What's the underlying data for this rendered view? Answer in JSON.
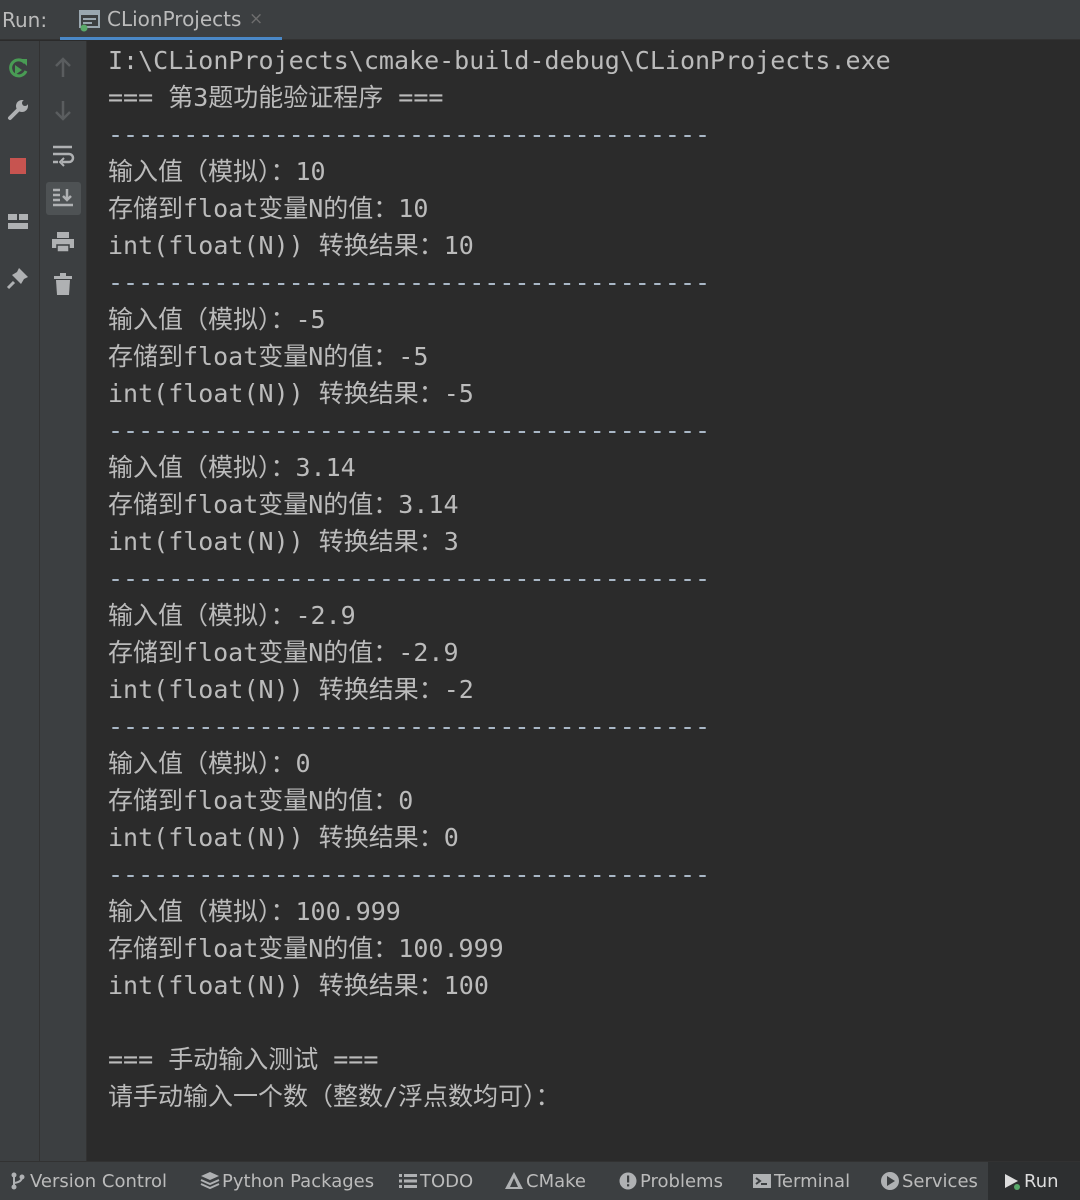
{
  "header": {
    "run_label": "Run:",
    "tab_title": "CLionProjects",
    "tab_close": "×"
  },
  "console": {
    "lines": [
      "I:\\CLionProjects\\cmake-build-debug\\CLionProjects.exe",
      "=== 第3题功能验证程序 ===",
      "----------------------------------------",
      "输入值（模拟）：10",
      "存储到float变量N的值：10",
      "int(float(N)) 转换结果：10",
      "----------------------------------------",
      "输入值（模拟）：-5",
      "存储到float变量N的值：-5",
      "int(float(N)) 转换结果：-5",
      "----------------------------------------",
      "输入值（模拟）：3.14",
      "存储到float变量N的值：3.14",
      "int(float(N)) 转换结果：3",
      "----------------------------------------",
      "输入值（模拟）：-2.9",
      "存储到float变量N的值：-2.9",
      "int(float(N)) 转换结果：-2",
      "----------------------------------------",
      "输入值（模拟）：0",
      "存储到float变量N的值：0",
      "int(float(N)) 转换结果：0",
      "----------------------------------------",
      "输入值（模拟）：100.999",
      "存储到float变量N的值：100.999",
      "int(float(N)) 转换结果：100",
      "",
      "=== 手动输入测试 ===",
      "请手动输入一个数（整数/浮点数均可）："
    ]
  },
  "bottom_bar": {
    "items": [
      {
        "label": "Version Control",
        "icon": "version-control-icon"
      },
      {
        "label": "Python Packages",
        "icon": "python-packages-icon"
      },
      {
        "label": "TODO",
        "icon": "todo-icon"
      },
      {
        "label": "CMake",
        "icon": "cmake-icon"
      },
      {
        "label": "Problems",
        "icon": "problems-icon"
      },
      {
        "label": "Terminal",
        "icon": "terminal-icon"
      },
      {
        "label": "Services",
        "icon": "services-icon"
      },
      {
        "label": "Run",
        "icon": "run-icon",
        "active": true
      }
    ]
  },
  "colors": {
    "background": "#2b2b2b",
    "panel": "#3c3f41",
    "text": "#bbbbbb",
    "rerun_green": "#499c54",
    "stop_red": "#c75450",
    "tab_underline": "#4a88c7"
  }
}
